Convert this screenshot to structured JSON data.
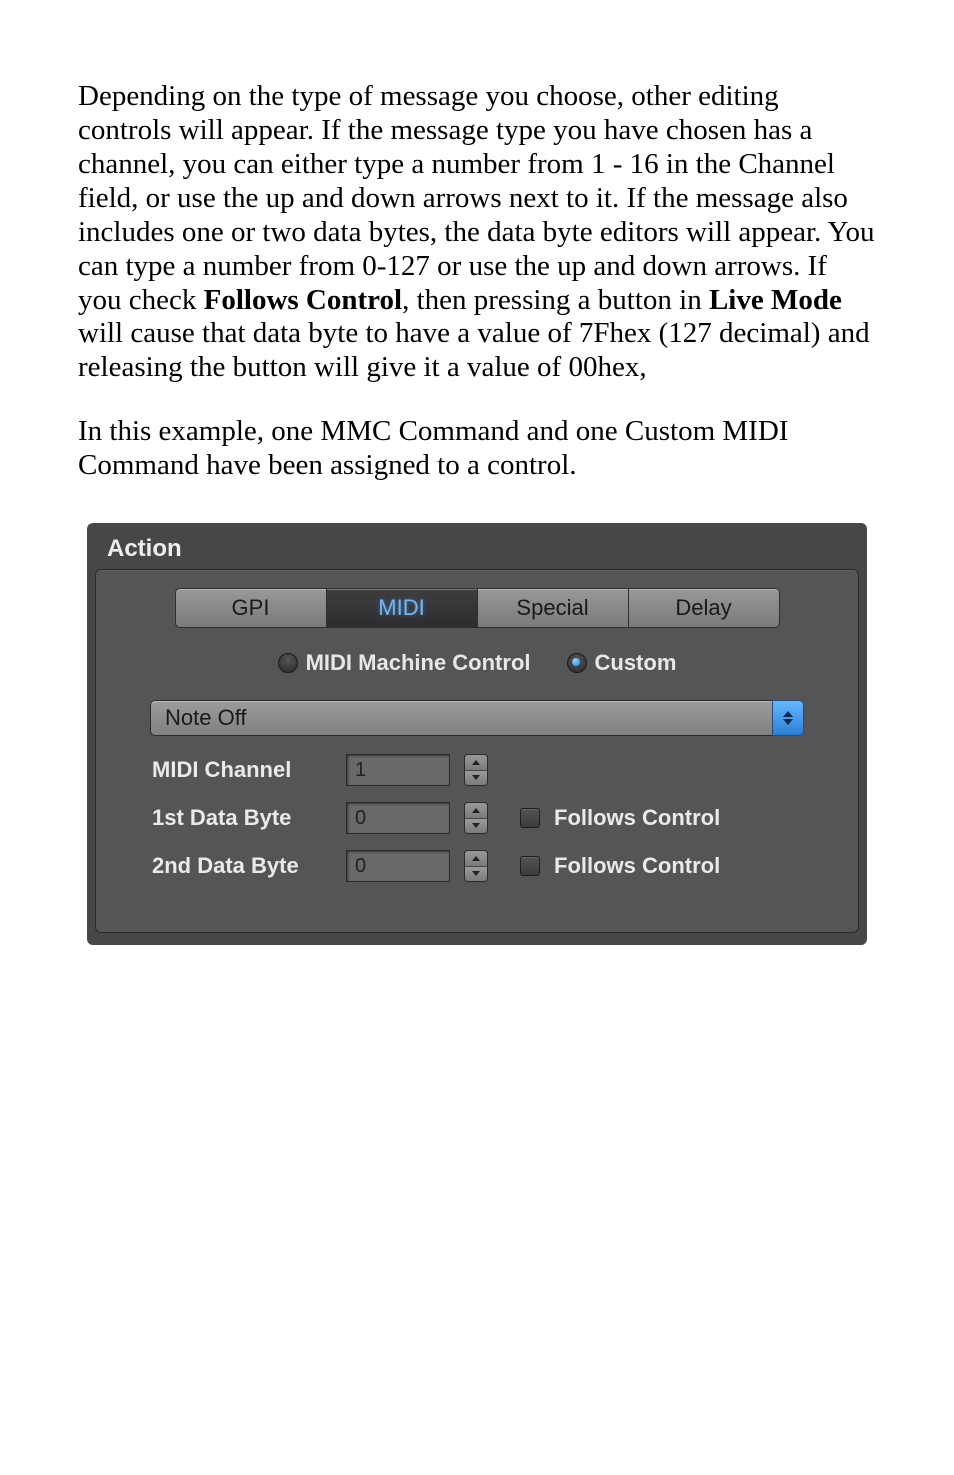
{
  "paragraphs": {
    "p1_a": "Depending on the type of message you choose, other editing controls will appear.  If the message type you have chosen has a channel, you can either type a number from 1 - 16 in the Channel field, or use the up and down arrows next to it.  If the message also includes one or two data bytes, the data byte editors will appear.  You can type a number from 0-127 or use the up and down arrows. If you check ",
    "p1_b1": "Follows Control",
    "p1_c": ", then pressing a button in ",
    "p1_b2": "Live Mode",
    "p1_d": " will cause that data byte to have a value of 7Fhex (127 decimal) and releasing the button will give it a value of 00hex,",
    "p2": "In this example, one MMC Command and one Custom MIDI Command have been assigned to a control."
  },
  "panel": {
    "title": "Action",
    "tabs": [
      "GPI",
      "MIDI",
      "Special",
      "Delay"
    ],
    "active_tab_index": 1,
    "radios": {
      "mmc": "MIDI Machine Control",
      "custom": "Custom",
      "selected": "custom"
    },
    "dropdown_value": "Note Off",
    "rows": {
      "midi_channel": {
        "label": "MIDI Channel",
        "value": "1"
      },
      "data1": {
        "label": "1st Data Byte",
        "value": "0",
        "follows_label": "Follows Control",
        "follows_checked": false
      },
      "data2": {
        "label": "2nd Data Byte",
        "value": "0",
        "follows_label": "Follows Control",
        "follows_checked": false
      }
    }
  }
}
